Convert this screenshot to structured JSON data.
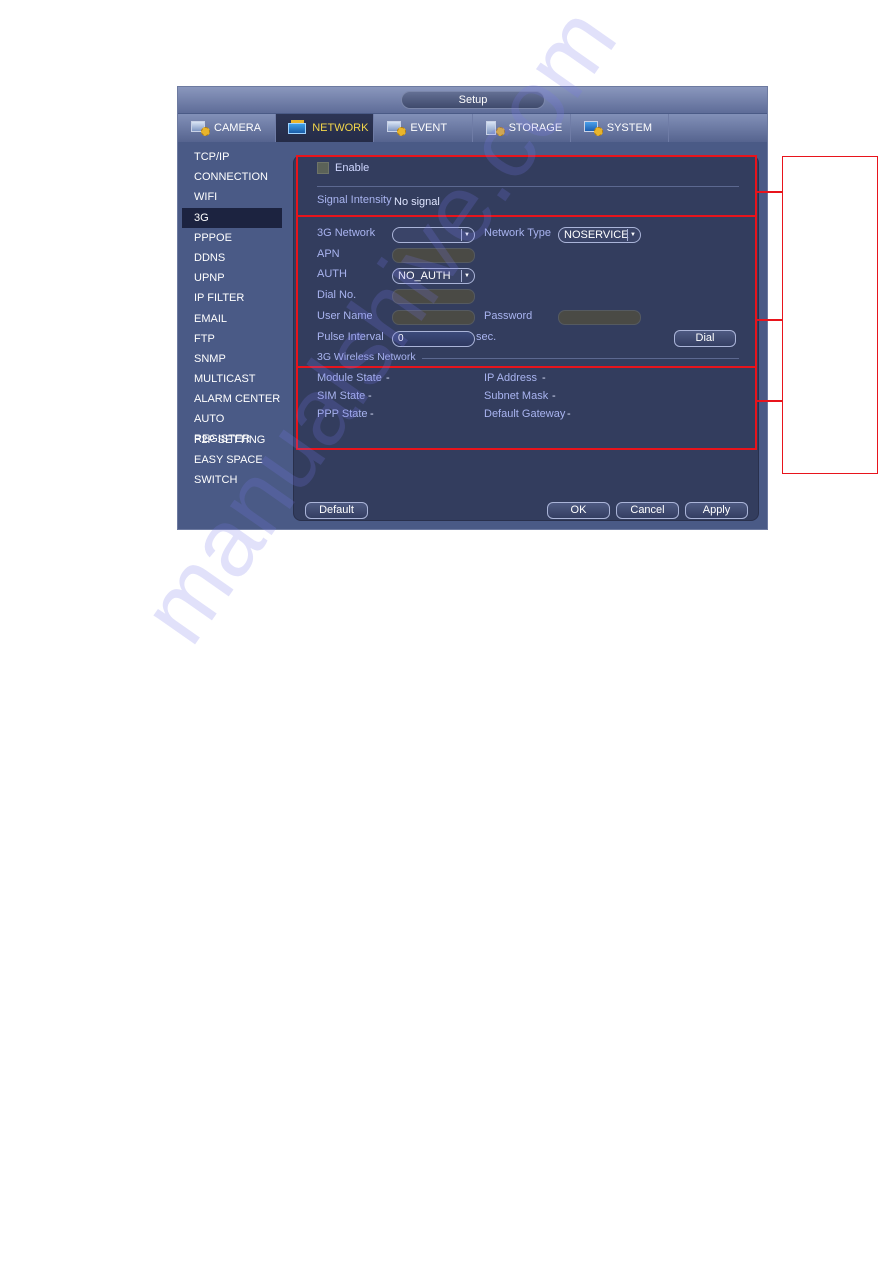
{
  "window": {
    "title": "Setup"
  },
  "tabs": [
    {
      "label": "CAMERA",
      "icon": "camera-gear-icon",
      "active": false
    },
    {
      "label": "NETWORK",
      "icon": "network-icon",
      "active": true
    },
    {
      "label": "EVENT",
      "icon": "event-gear-icon",
      "active": false
    },
    {
      "label": "STORAGE",
      "icon": "storage-gear-icon",
      "active": false
    },
    {
      "label": "SYSTEM",
      "icon": "system-gear-icon",
      "active": false
    }
  ],
  "sidebar": {
    "items": [
      {
        "label": "TCP/IP"
      },
      {
        "label": "CONNECTION"
      },
      {
        "label": "WIFI"
      },
      {
        "label": "3G",
        "active": true
      },
      {
        "label": "PPPOE"
      },
      {
        "label": "DDNS"
      },
      {
        "label": "UPNP"
      },
      {
        "label": "IP FILTER"
      },
      {
        "label": "EMAIL"
      },
      {
        "label": "FTP"
      },
      {
        "label": "SNMP"
      },
      {
        "label": "MULTICAST"
      },
      {
        "label": "ALARM CENTER"
      },
      {
        "label": "AUTO REGISTER"
      },
      {
        "label": "P2P SETTING"
      },
      {
        "label": "EASY SPACE"
      },
      {
        "label": "SWITCH"
      }
    ]
  },
  "section1": {
    "enable_label": "Enable",
    "enable_checked": false,
    "signal_label": "Signal Intensity",
    "signal_value": "No signal"
  },
  "section2": {
    "network_label": "3G Network",
    "network_value": "",
    "network_type_label": "Network Type",
    "network_type_value": "NOSERVICE",
    "apn_label": "APN",
    "apn_value": "",
    "auth_label": "AUTH",
    "auth_value": "NO_AUTH",
    "dial_no_label": "Dial No.",
    "dial_no_value": "",
    "username_label": "User Name",
    "username_value": "",
    "password_label": "Password",
    "password_value": "",
    "pulse_label": "Pulse Interval",
    "pulse_value": "0",
    "pulse_unit": "sec.",
    "dial_button": "Dial",
    "wireless_heading": "3G Wireless Network"
  },
  "section3": {
    "module_state_label": "Module State",
    "module_state_value": "-",
    "sim_state_label": "SIM State",
    "sim_state_value": "-",
    "ppp_state_label": "PPP State",
    "ppp_state_value": "-",
    "ip_address_label": "IP Address",
    "ip_address_value": "-",
    "subnet_mask_label": "Subnet Mask",
    "subnet_mask_value": "-",
    "gateway_label": "Default Gateway",
    "gateway_value": "-"
  },
  "footer": {
    "default_button": "Default",
    "ok_button": "OK",
    "cancel_button": "Cancel",
    "apply_button": "Apply"
  },
  "annotation": {
    "color": "#e8141c"
  },
  "watermark": {
    "text": "manualshive.com"
  }
}
